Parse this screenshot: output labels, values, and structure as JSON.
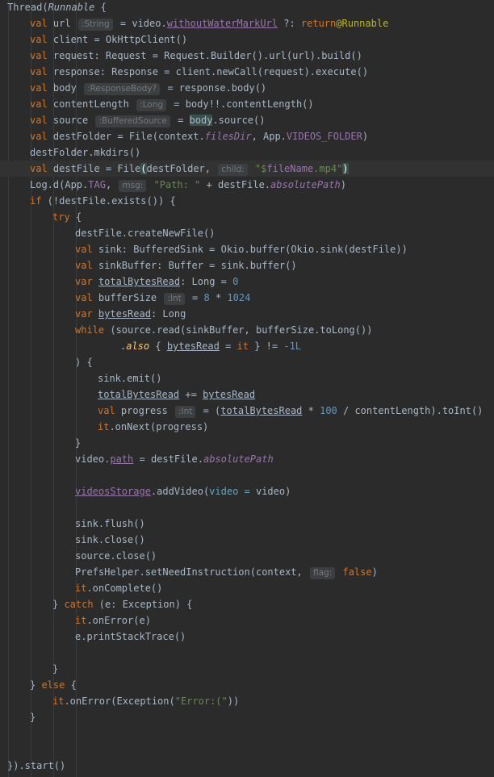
{
  "editor": {
    "lines": [
      {
        "l": 1,
        "indent": 0,
        "t": [
          [
            "Thread("
          ],
          [
            "Runnable",
            "ital"
          ],
          [
            " {"
          ]
        ]
      },
      {
        "l": 2,
        "indent": 1,
        "t": [
          [
            "val",
            "kw"
          ],
          [
            " url "
          ],
          [
            ":String",
            "hint"
          ],
          [
            " = video."
          ],
          [
            "withoutWaterMarkUrl",
            "prop ul"
          ],
          [
            " ?: "
          ],
          [
            "return",
            "kw"
          ],
          [
            "@Runnable",
            "lbl"
          ]
        ]
      },
      {
        "l": 3,
        "indent": 1,
        "t": [
          [
            "val",
            "kw"
          ],
          [
            " client = OkHttpClient()"
          ]
        ]
      },
      {
        "l": 4,
        "indent": 1,
        "t": [
          [
            "val",
            "kw"
          ],
          [
            " request: Request = Request.Builder().url(url).build()"
          ]
        ]
      },
      {
        "l": 5,
        "indent": 1,
        "t": [
          [
            "val",
            "kw"
          ],
          [
            " response: Response = client.newCall(request).execute()"
          ]
        ]
      },
      {
        "l": 6,
        "indent": 1,
        "t": [
          [
            "val",
            "kw"
          ],
          [
            " body "
          ],
          [
            ":ResponseBody?",
            "hint"
          ],
          [
            " = response.body()"
          ]
        ]
      },
      {
        "l": 7,
        "indent": 1,
        "t": [
          [
            "val",
            "kw"
          ],
          [
            " contentLength "
          ],
          [
            ":Long",
            "hint"
          ],
          [
            " = body!!.contentLength()"
          ]
        ]
      },
      {
        "l": 8,
        "indent": 1,
        "t": [
          [
            "val",
            "kw"
          ],
          [
            " source "
          ],
          [
            ":BufferedSource",
            "hint"
          ],
          [
            " = "
          ],
          [
            "body",
            "bm"
          ],
          [
            ".source()"
          ]
        ]
      },
      {
        "l": 9,
        "indent": 1,
        "t": [
          [
            "val",
            "kw"
          ],
          [
            " destFolder = File(context."
          ],
          [
            "filesDir",
            "prop ital"
          ],
          [
            ", App."
          ],
          [
            "VIDEOS_FOLDER",
            "prop"
          ],
          [
            ")"
          ]
        ]
      },
      {
        "l": 10,
        "indent": 1,
        "t": [
          [
            "destFolder.mkdirs()"
          ]
        ]
      },
      {
        "l": 11,
        "indent": 1,
        "current": true,
        "t": [
          [
            "val",
            "kw"
          ],
          [
            " destFile = File"
          ],
          [
            "(",
            "paren-match"
          ],
          [
            "destFolder, "
          ],
          [
            "child:",
            "hint"
          ],
          [
            " "
          ],
          [
            "\"$",
            "str"
          ],
          [
            "fileName",
            "prop"
          ],
          [
            ".mp4\"",
            "str"
          ],
          [
            ")",
            "paren-match"
          ]
        ]
      },
      {
        "l": 12,
        "indent": 1,
        "t": [
          [
            "Log.d(App."
          ],
          [
            "TAG",
            "prop"
          ],
          [
            ", "
          ],
          [
            "msg:",
            "hint"
          ],
          [
            " "
          ],
          [
            "\"Path: \"",
            "str"
          ],
          [
            " + destFile."
          ],
          [
            "absolutePath",
            "prop ital"
          ],
          [
            ")"
          ]
        ]
      },
      {
        "l": 13,
        "indent": 1,
        "t": [
          [
            "if",
            "kw"
          ],
          [
            " (!destFile.exists()) {"
          ]
        ]
      },
      {
        "l": 14,
        "indent": 2,
        "t": [
          [
            "try",
            "kw"
          ],
          [
            " {"
          ]
        ]
      },
      {
        "l": 15,
        "indent": 3,
        "t": [
          [
            "destFile.createNewFile()"
          ]
        ]
      },
      {
        "l": 16,
        "indent": 3,
        "t": [
          [
            "val",
            "kw"
          ],
          [
            " sink: BufferedSink = Okio.buffer(Okio.sink(destFile))"
          ]
        ]
      },
      {
        "l": 17,
        "indent": 3,
        "t": [
          [
            "val",
            "kw"
          ],
          [
            " sinkBuffer: Buffer = sink.buffer()"
          ]
        ]
      },
      {
        "l": 18,
        "indent": 3,
        "t": [
          [
            "var",
            "kw"
          ],
          [
            " "
          ],
          [
            "totalBytesRead",
            "ul"
          ],
          [
            ": Long = "
          ],
          [
            "0",
            "num"
          ]
        ]
      },
      {
        "l": 19,
        "indent": 3,
        "t": [
          [
            "val",
            "kw"
          ],
          [
            " bufferSize "
          ],
          [
            ":Int",
            "hint"
          ],
          [
            " = "
          ],
          [
            "8",
            "num"
          ],
          [
            " * "
          ],
          [
            "1024",
            "num"
          ]
        ]
      },
      {
        "l": 20,
        "indent": 3,
        "t": [
          [
            "var",
            "kw"
          ],
          [
            " "
          ],
          [
            "bytesRead",
            "ul"
          ],
          [
            ": Long"
          ]
        ]
      },
      {
        "l": 21,
        "indent": 3,
        "t": [
          [
            "while",
            "kw"
          ],
          [
            " (source.read(sinkBuffer, bufferSize.toLong())"
          ]
        ]
      },
      {
        "l": 22,
        "indent": 5,
        "t": [
          [
            "."
          ],
          [
            "also",
            "fn ital"
          ],
          [
            " { "
          ],
          [
            "bytesRead",
            "ul"
          ],
          [
            " = "
          ],
          [
            "it",
            "kw"
          ],
          [
            " } != "
          ],
          [
            "-1L",
            "num"
          ]
        ]
      },
      {
        "l": 23,
        "indent": 3,
        "t": [
          [
            ") {"
          ]
        ]
      },
      {
        "l": 24,
        "indent": 4,
        "t": [
          [
            "sink.emit()"
          ]
        ]
      },
      {
        "l": 25,
        "indent": 4,
        "t": [
          [
            "totalBytesRead",
            "ul"
          ],
          [
            " += "
          ],
          [
            "bytesRead",
            "ul"
          ]
        ]
      },
      {
        "l": 26,
        "indent": 4,
        "t": [
          [
            "val",
            "kw"
          ],
          [
            " progress "
          ],
          [
            ":Int",
            "hint"
          ],
          [
            " = ("
          ],
          [
            "totalBytesRead",
            "ul"
          ],
          [
            " * "
          ],
          [
            "100",
            "num"
          ],
          [
            " / contentLength).toInt()"
          ]
        ]
      },
      {
        "l": 27,
        "indent": 4,
        "t": [
          [
            "it",
            "kw"
          ],
          [
            ".onNext(progress)"
          ]
        ]
      },
      {
        "l": 28,
        "indent": 3,
        "t": [
          [
            "}"
          ]
        ]
      },
      {
        "l": 29,
        "indent": 3,
        "t": [
          [
            "video."
          ],
          [
            "path",
            "prop ul"
          ],
          [
            " = destFile."
          ],
          [
            "absolutePath",
            "prop ital"
          ]
        ]
      },
      {
        "l": 30,
        "indent": 0,
        "t": []
      },
      {
        "l": 31,
        "indent": 3,
        "t": [
          [
            "videosStorage",
            "prop ul"
          ],
          [
            ".addVideo("
          ],
          [
            "video = ",
            "ann"
          ],
          [
            "video)"
          ]
        ]
      },
      {
        "l": 32,
        "indent": 0,
        "t": []
      },
      {
        "l": 33,
        "indent": 3,
        "t": [
          [
            "sink.flush()"
          ]
        ]
      },
      {
        "l": 34,
        "indent": 3,
        "t": [
          [
            "sink.close()"
          ]
        ]
      },
      {
        "l": 35,
        "indent": 3,
        "t": [
          [
            "source.close()"
          ]
        ]
      },
      {
        "l": 36,
        "indent": 3,
        "t": [
          [
            "PrefsHelper.setNeedInstruction(context, "
          ],
          [
            "flag:",
            "hint"
          ],
          [
            " "
          ],
          [
            "false",
            "kw"
          ],
          [
            ")"
          ]
        ]
      },
      {
        "l": 37,
        "indent": 3,
        "t": [
          [
            "it",
            "kw"
          ],
          [
            ".onComplete()"
          ]
        ]
      },
      {
        "l": 38,
        "indent": 2,
        "t": [
          [
            "} "
          ],
          [
            "catch",
            "kw"
          ],
          [
            " (e: Exception) {"
          ]
        ]
      },
      {
        "l": 39,
        "indent": 3,
        "t": [
          [
            "it",
            "kw"
          ],
          [
            ".onError(e)"
          ]
        ]
      },
      {
        "l": 40,
        "indent": 3,
        "t": [
          [
            "e.printStackTrace()"
          ]
        ]
      },
      {
        "l": 41,
        "indent": 0,
        "t": []
      },
      {
        "l": 42,
        "indent": 2,
        "t": [
          [
            "}"
          ]
        ]
      },
      {
        "l": 43,
        "indent": 1,
        "t": [
          [
            "} "
          ],
          [
            "else",
            "kw"
          ],
          [
            " {"
          ]
        ]
      },
      {
        "l": 44,
        "indent": 2,
        "t": [
          [
            "it",
            "kw"
          ],
          [
            ".onError(Exception("
          ],
          [
            "\"Error:(\"",
            "str"
          ],
          [
            "))"
          ]
        ]
      },
      {
        "l": 45,
        "indent": 1,
        "t": [
          [
            "}"
          ]
        ]
      },
      {
        "l": 46,
        "indent": 0,
        "t": []
      },
      {
        "l": 47,
        "indent": 0,
        "t": []
      },
      {
        "l": 48,
        "indent": 0,
        "t": [
          [
            "}).start()"
          ]
        ]
      }
    ]
  }
}
